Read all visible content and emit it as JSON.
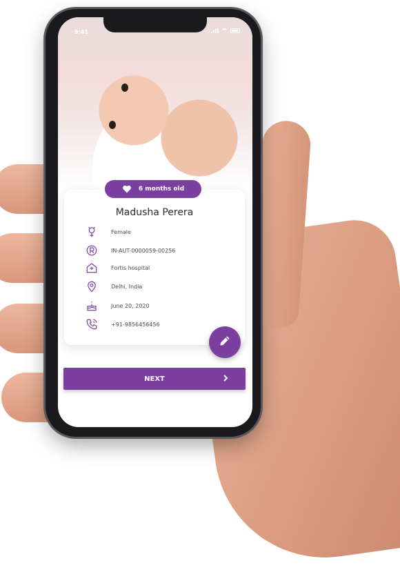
{
  "status_bar": {
    "time": "9:41"
  },
  "profile": {
    "age_badge": "6 months old",
    "name": "Madusha Perera",
    "details": [
      {
        "icon": "gender-icon",
        "value": "Female"
      },
      {
        "icon": "registered-icon",
        "value": "IN-AUT-0000059-00256"
      },
      {
        "icon": "hospital-icon",
        "value": "Fortis hospital"
      },
      {
        "icon": "location-pin-icon",
        "value": "Delhi, India"
      },
      {
        "icon": "birthday-cake-icon",
        "value": "June 20, 2020"
      },
      {
        "icon": "phone-icon",
        "value": "+91-9856456456"
      }
    ]
  },
  "actions": {
    "next_label": "NEXT",
    "edit_icon": "pencil-icon"
  },
  "colors": {
    "accent": "#7b3fa0",
    "text": "#2c2c2c",
    "icon": "#7b3fa0"
  }
}
